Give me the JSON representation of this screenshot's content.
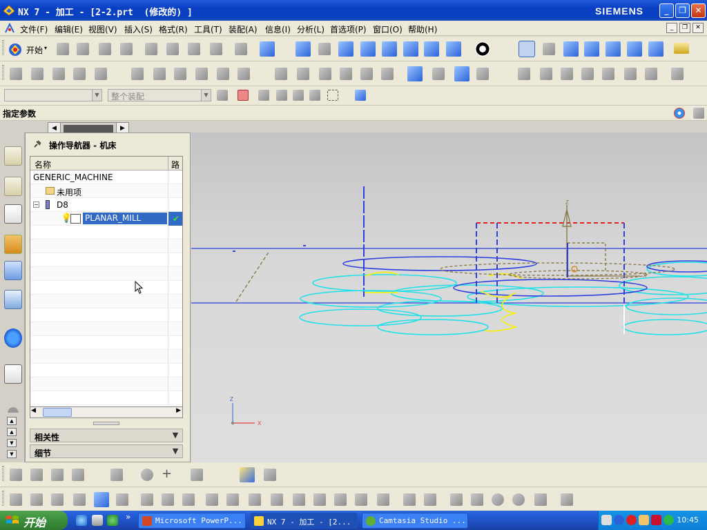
{
  "window": {
    "title": "NX 7 - 加工 - [2-2.prt  (修改的) ]",
    "brand": "SIEMENS",
    "minimize_glyph": "_",
    "restore_glyph": "❐",
    "close_glyph": "✕"
  },
  "menubar": {
    "items": [
      "文件(F)",
      "编辑(E)",
      "视图(V)",
      "插入(S)",
      "格式(R)",
      "工具(T)",
      "装配(A)",
      "信息(I)",
      "分析(L)",
      "首选项(P)",
      "窗口(O)",
      "帮助(H)"
    ]
  },
  "toolbar_standard": {
    "start_label": "开始"
  },
  "selection_bar": {
    "filter_placeholder": "",
    "scope_value": "整个装配"
  },
  "cue_line": {
    "text": "指定参数"
  },
  "navigator": {
    "title": "操作导航器 - 机床",
    "columns": [
      "名称",
      "路"
    ],
    "rows": [
      {
        "label": "GENERIC_MACHINE",
        "level": 0
      },
      {
        "label": "未用项",
        "level": 1
      },
      {
        "label": "D8",
        "level": 1
      },
      {
        "label": "PLANAR_MILL",
        "level": 2,
        "selected": true,
        "status": "✔"
      }
    ],
    "panels": [
      "相关性",
      "细节"
    ]
  },
  "graphics": {
    "wcs_labels": {
      "z": "Z",
      "x": "X"
    },
    "colors": {
      "toolpath_cyan": "#22e0e8",
      "toolpath_blue": "#2d3fe0",
      "toolpath_yellow": "#f2ee16",
      "boundary_red": "#e02020",
      "tool_olive": "#8a7a4a"
    }
  },
  "taskbar": {
    "start": "开始",
    "tasks": [
      {
        "label": "Microsoft PowerP...",
        "active": false
      },
      {
        "label": "NX 7 - 加工 - [2...",
        "active": true
      },
      {
        "label": "Camtasia Studio ...",
        "active": false
      }
    ],
    "clock": "10:45",
    "quicklaunch_more": "»"
  }
}
